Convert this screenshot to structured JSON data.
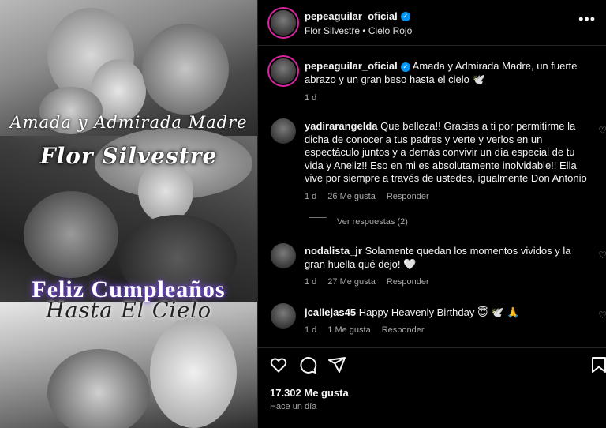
{
  "image": {
    "overlay": {
      "line1": "Amada y Admirada Madre",
      "line2": "Flor Silvestre",
      "line3": "Feliz Cumpleaños",
      "line4": "Hasta El Cielo"
    }
  },
  "header": {
    "username": "pepeaguilar_oficial",
    "subtitle": "Flor Silvestre • Cielo Rojo",
    "more_icon": "more-horizontal-icon"
  },
  "caption": {
    "username": "pepeaguilar_oficial",
    "text": "Amada y Admirada Madre, un fuerte abrazo y un gran beso hasta el cielo 🕊️",
    "time": "1 d"
  },
  "comments": [
    {
      "username": "yadirarangelda",
      "text": "Que belleza!! Gracias a ti por permitirme la dicha de conocer a tus padres y verte y verlos en un espectáculo juntos y a demás convivir un día especial de tu vida y Aneliz!! Eso en mi es absolutamente inolvidable!! Ella vive por siempre a través de ustedes, igualmente Don Antonio",
      "time": "1 d",
      "likes": "26 Me gusta",
      "reply": "Responder",
      "view_replies": "Ver respuestas (2)"
    },
    {
      "username": "nodalista_jr",
      "text": "Solamente quedan los momentos vividos y la gran huella qué dejo! 🤍",
      "time": "1 d",
      "likes": "27 Me gusta",
      "reply": "Responder"
    },
    {
      "username": "jcallejas45",
      "text": "Happy Heavenly Birthday 😇 🕊️ 🙏",
      "time": "1 d",
      "likes": "1 Me gusta",
      "reply": "Responder"
    }
  ],
  "actions": {
    "like_icon": "heart-icon",
    "comment_icon": "comment-icon",
    "share_icon": "send-icon",
    "save_icon": "bookmark-icon",
    "likes_count": "17.302 Me gusta",
    "posted": "Hace un día"
  },
  "colors": {
    "background": "#000000",
    "verified": "#0095f6",
    "muted": "#a8a8a8",
    "divider": "#262626",
    "glow": "#8a5cff"
  }
}
